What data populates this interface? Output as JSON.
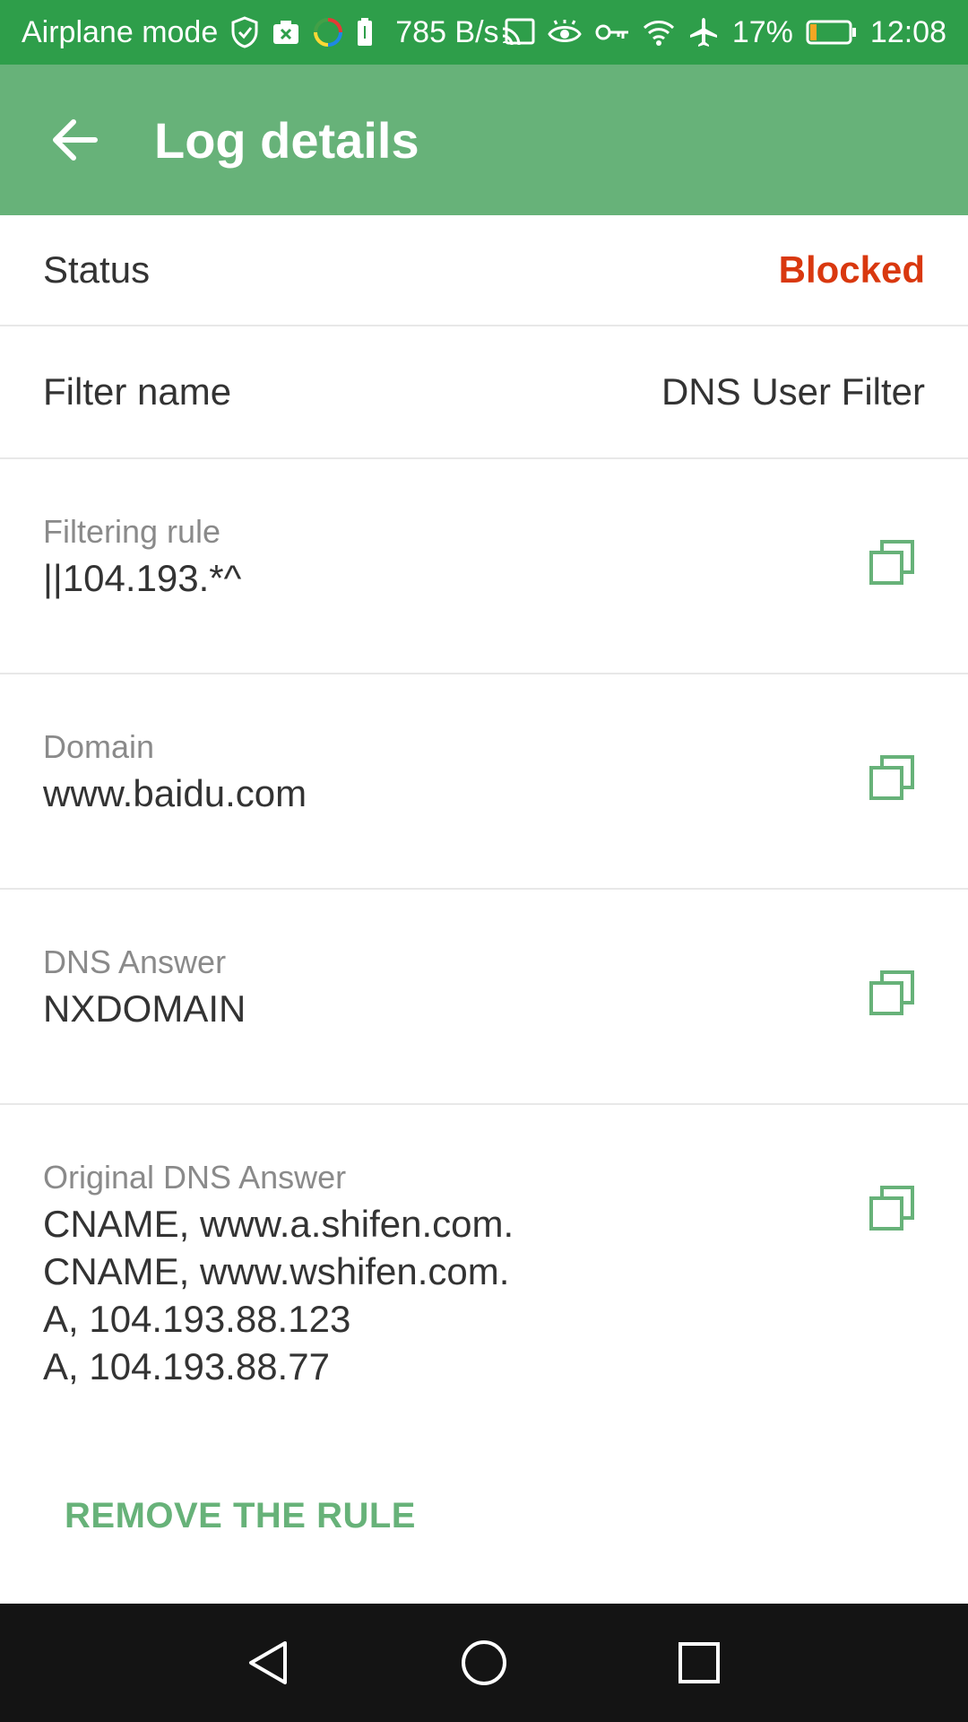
{
  "status_bar": {
    "airplane_label": "Airplane mode",
    "net_speed": "785 B/s",
    "battery_percent": "17%",
    "time": "12:08",
    "icons": [
      "shield-icon",
      "camera-icon",
      "sync-icon",
      "battery-small-icon",
      "cast-icon",
      "eye-icon",
      "vpn-key-icon",
      "wifi-icon",
      "airplane-icon",
      "battery-icon"
    ],
    "battery_level": 0.17
  },
  "app_bar": {
    "title": "Log details",
    "back_icon": "arrow-back-icon"
  },
  "rows": {
    "status": {
      "label": "Status",
      "value": "Blocked"
    },
    "filter_name": {
      "label": "Filter name",
      "value": "DNS User Filter"
    },
    "filtering_rule": {
      "label": "Filtering rule",
      "value": "||104.193.*^"
    },
    "domain": {
      "label": "Domain",
      "value": "www.baidu.com"
    },
    "dns_answer": {
      "label": "DNS Answer",
      "value": "NXDOMAIN"
    },
    "original_dns_answer": {
      "label": "Original DNS Answer",
      "lines": [
        "CNAME, www.a.shifen.com.",
        "CNAME, www.wshifen.com.",
        "A, 104.193.88.123",
        "A, 104.193.88.77"
      ]
    }
  },
  "actions": {
    "remove_rule": "REMOVE THE RULE",
    "copy_icon": "copy-icon"
  },
  "nav_bar": {
    "icons": [
      "back-triangle-icon",
      "home-circle-icon",
      "recents-square-icon"
    ]
  },
  "colors": {
    "status_bar": "#2e9e4a",
    "app_bar": "#67b279",
    "blocked": "#d9380f",
    "accent": "#67b279",
    "nav_bar": "#141414"
  }
}
